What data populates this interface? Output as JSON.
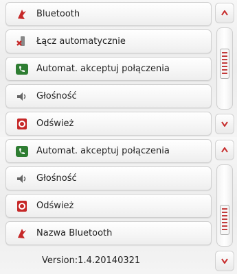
{
  "screens": [
    {
      "items": [
        {
          "label": "Bluetooth",
          "icon": "bluetooth-icon",
          "color": "#c62828"
        },
        {
          "label": "Łącz automatycznie",
          "icon": "auto-connect-icon",
          "color": "#b71c1c"
        },
        {
          "label": "Automat. akceptuj połączenia",
          "icon": "accept-call-icon",
          "color": "#2e7d32"
        },
        {
          "label": "Głośność",
          "icon": "volume-icon",
          "color": "#6d6d6d"
        },
        {
          "label": "Odśwież",
          "icon": "refresh-icon",
          "color": "#c62828"
        }
      ],
      "scroll_position": 0.35
    },
    {
      "items": [
        {
          "label": "Automat. akceptuj połączenia",
          "icon": "accept-call-icon",
          "color": "#2e7d32"
        },
        {
          "label": "Głośność",
          "icon": "volume-icon",
          "color": "#6d6d6d"
        },
        {
          "label": "Odśwież",
          "icon": "refresh-icon",
          "color": "#c62828"
        },
        {
          "label": "Nazwa Bluetooth",
          "icon": "bluetooth-name-icon",
          "color": "#c62828"
        }
      ],
      "version": "Version:1.4.20140321",
      "scroll_position": 0.7
    }
  ]
}
